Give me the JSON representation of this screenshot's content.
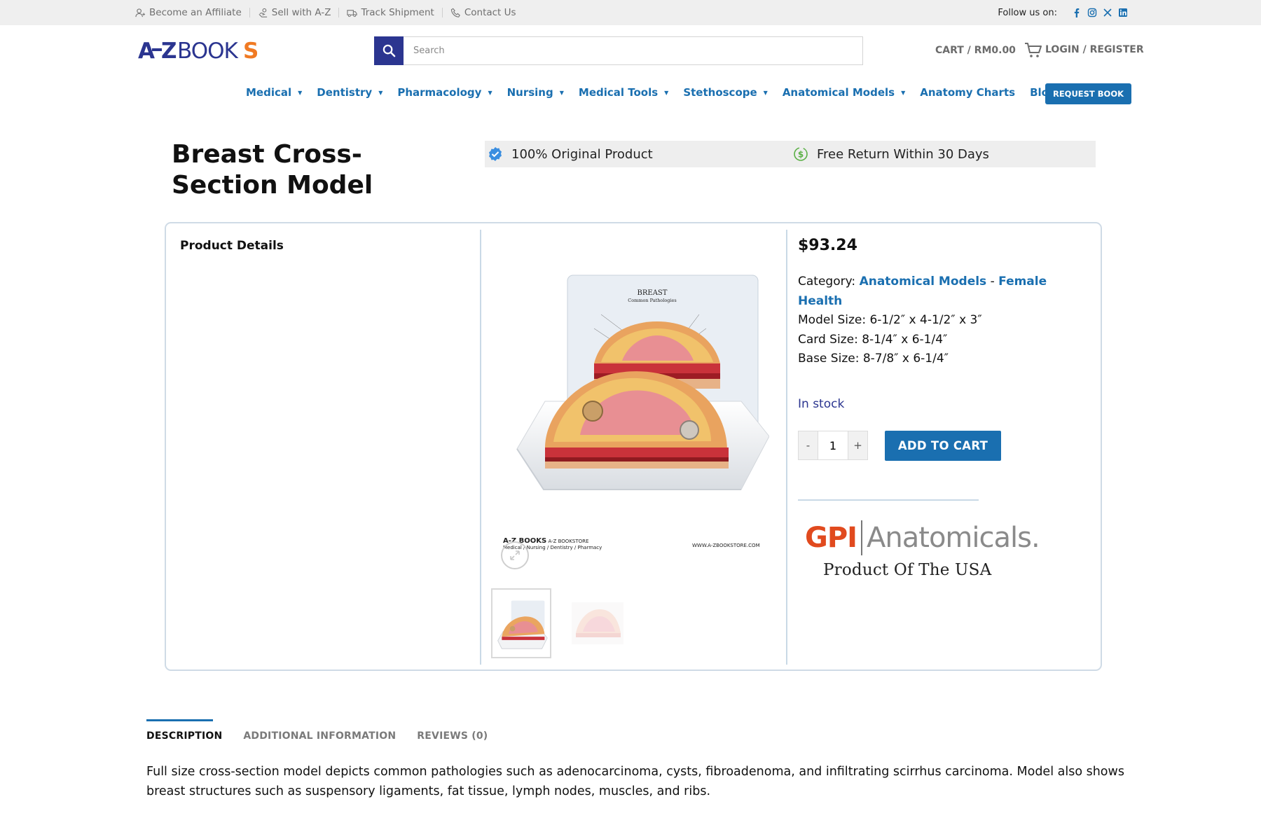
{
  "topbar": {
    "links": [
      {
        "label": "Become an Affiliate",
        "icon": "affiliate-icon"
      },
      {
        "label": "Sell with A-Z",
        "icon": "sell-icon"
      },
      {
        "label": "Track Shipment",
        "icon": "truck-icon"
      },
      {
        "label": "Contact Us",
        "icon": "phone-icon"
      }
    ],
    "follow_label": "Follow us on:",
    "socials": [
      "facebook-icon",
      "instagram-icon",
      "x-icon",
      "linkedin-icon"
    ]
  },
  "header": {
    "logo_text": "A-ZBOOKS",
    "search_placeholder": "Search",
    "cart_label": "CART / RM0.00",
    "login_label": "LOGIN / REGISTER"
  },
  "nav": {
    "items": [
      {
        "label": "Medical",
        "has_dropdown": true
      },
      {
        "label": "Dentistry",
        "has_dropdown": true
      },
      {
        "label": "Pharmacology",
        "has_dropdown": true
      },
      {
        "label": "Nursing",
        "has_dropdown": true
      },
      {
        "label": "Medical Tools",
        "has_dropdown": true
      },
      {
        "label": "Stethoscope",
        "has_dropdown": true
      },
      {
        "label": "Anatomical Models",
        "has_dropdown": true
      },
      {
        "label": "Anatomy Charts",
        "has_dropdown": false
      },
      {
        "label": "Blogs",
        "has_dropdown": false
      }
    ],
    "request_button": "REQUEST BOOK"
  },
  "product": {
    "title": "Breast Cross-Section Model",
    "badges": [
      "100% Original Product",
      "Free Return Within 30 Days"
    ],
    "details_label": "Product Details",
    "price": "$93.24",
    "category_label": "Category:",
    "category_1": "Anatomical Models",
    "category_sep": "-",
    "category_2": "Female Health",
    "specs": [
      "Model Size: 6-1/2″ x 4-1/2″ x 3″",
      "Card Size: 8-1/4″ x 6-1/4″",
      "Base Size:  8-7/8″ x 6-1/4″"
    ],
    "stock": "In stock",
    "quantity": "1",
    "qty_minus": "-",
    "qty_plus": "+",
    "add_to_cart": "ADD TO CART",
    "image": {
      "card_title": "BREAST",
      "card_subtitle": "Common Pathologies",
      "watermark_left_brand": "A-Z BOOKS",
      "watermark_left_sub": "A-Z BOOKSTORE",
      "watermark_left_line": "Medical / Nursing / Dentistry / Pharmacy",
      "watermark_right": "WWW.A-ZBOOKSTORE.COM"
    },
    "brand": {
      "name_bold": "GPI",
      "name_light": "Anatomicals.",
      "tagline": "Product Of The USA"
    }
  },
  "tabs": [
    {
      "label": "DESCRIPTION",
      "active": true
    },
    {
      "label": "ADDITIONAL INFORMATION",
      "active": false
    },
    {
      "label": "REVIEWS (0)",
      "active": false
    }
  ],
  "description": "Full size cross-section model depicts common pathologies such as adenocarcinoma, cysts, fibroadenoma, and infiltrating scirrhus carcinoma. Model also shows breast structures such as suspensory ligaments, fat tissue, lymph nodes, muscles, and ribs.",
  "colors": {
    "primary_blue": "#1a6fb0",
    "navy": "#2b3590",
    "logo_orange": "#f07a23",
    "topbar_bg": "#efefef"
  }
}
